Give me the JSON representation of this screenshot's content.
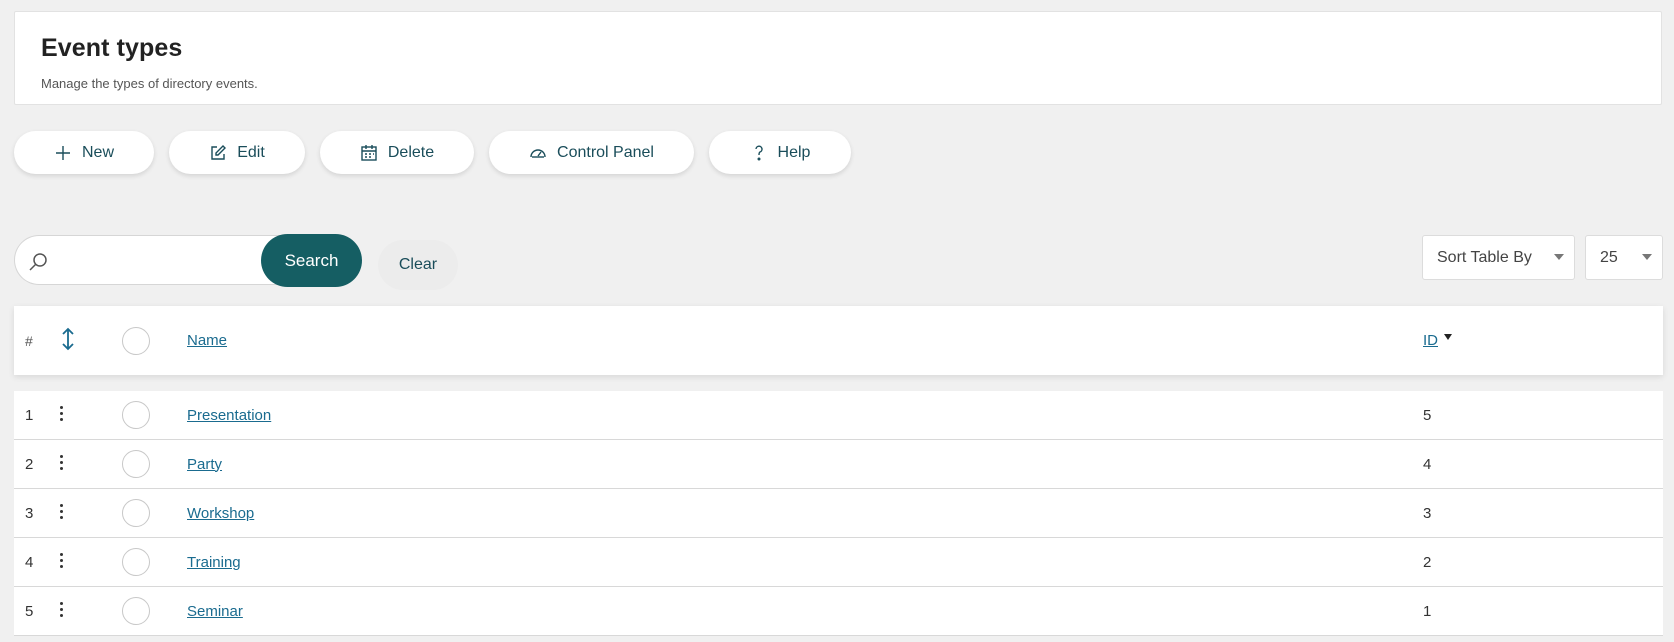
{
  "header": {
    "title": "Event types",
    "subtitle": "Manage the types of directory events."
  },
  "toolbar": [
    {
      "label": "New",
      "icon": "plus-icon"
    },
    {
      "label": "Edit",
      "icon": "edit-icon"
    },
    {
      "label": "Delete",
      "icon": "calendar-icon"
    },
    {
      "label": "Control Panel",
      "icon": "gauge-icon"
    },
    {
      "label": "Help",
      "icon": "question-icon"
    }
  ],
  "search": {
    "value": "",
    "button_label": "Search",
    "clear_label": "Clear"
  },
  "sort": {
    "label": "Sort Table By"
  },
  "per_page": {
    "value": "25"
  },
  "table": {
    "headers": {
      "num": "#",
      "name": "Name",
      "id": "ID"
    },
    "sorted_column": "ID",
    "sort_direction": "descending",
    "rows": [
      {
        "num": "1",
        "name": "Presentation",
        "id": "5"
      },
      {
        "num": "2",
        "name": "Party",
        "id": "4"
      },
      {
        "num": "3",
        "name": "Workshop",
        "id": "3"
      },
      {
        "num": "4",
        "name": "Training",
        "id": "2"
      },
      {
        "num": "5",
        "name": "Seminar",
        "id": "1"
      }
    ]
  },
  "colors": {
    "accent": "#155e63",
    "link": "#1a6b8f",
    "background": "#f0f0f0"
  }
}
